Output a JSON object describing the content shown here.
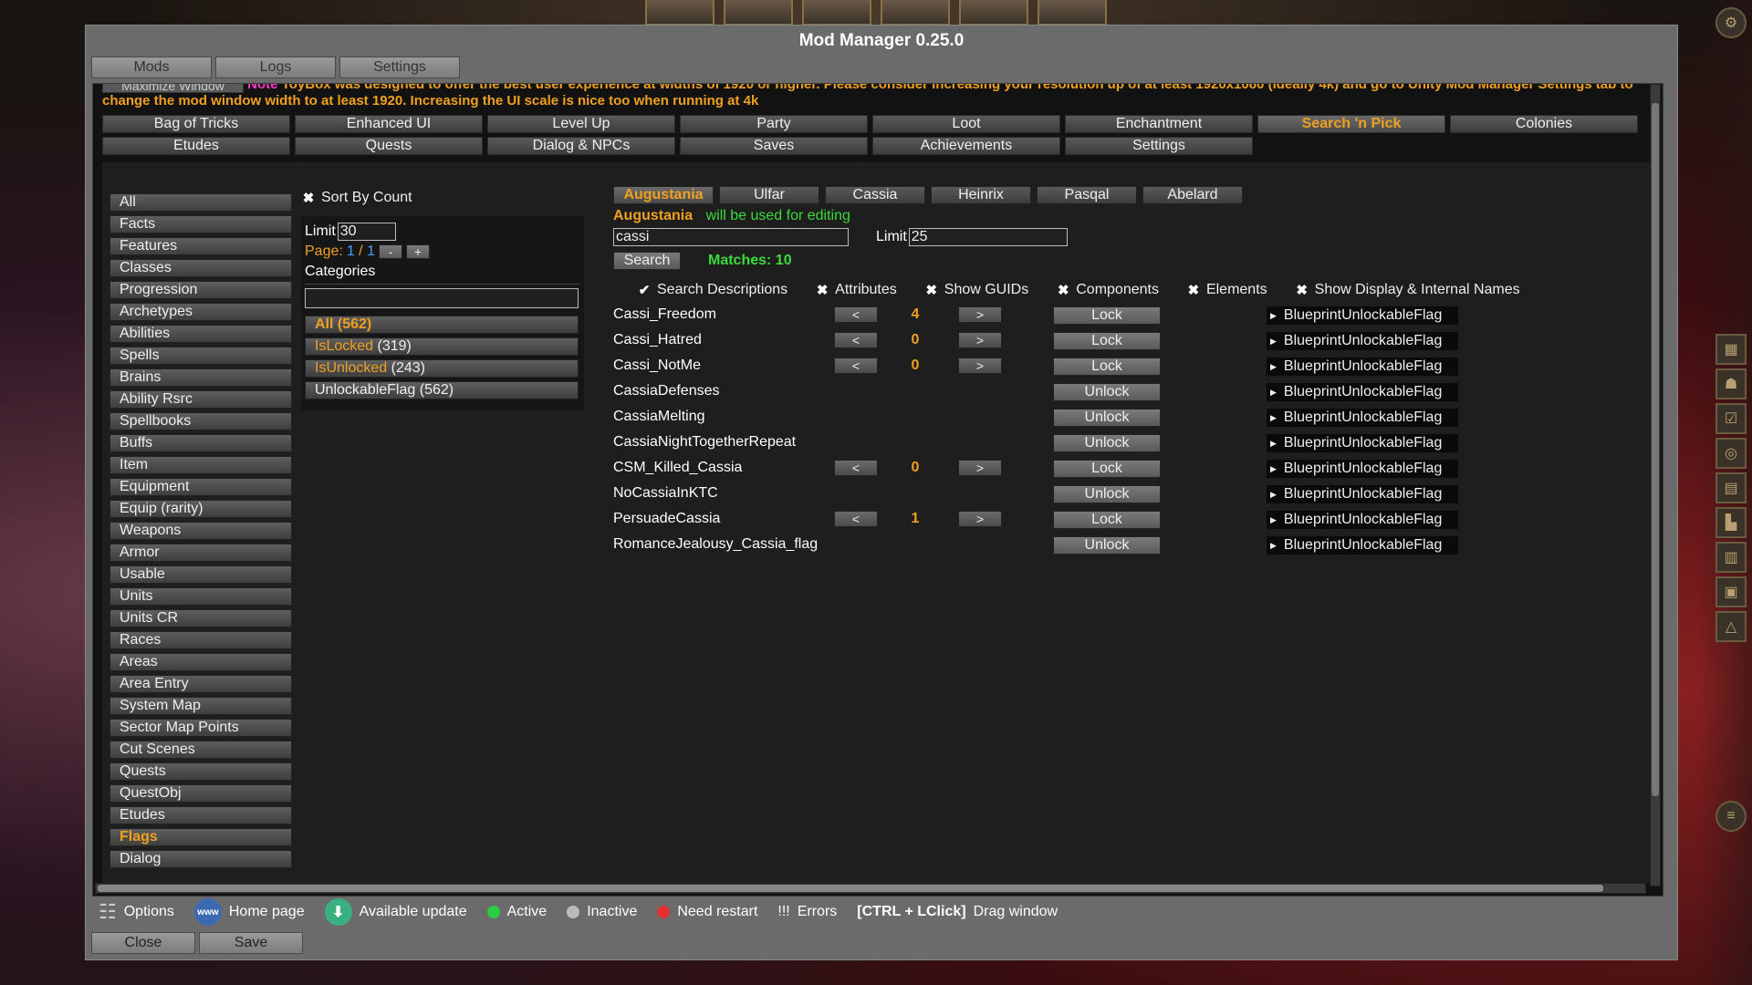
{
  "window_title": "Mod Manager 0.25.0",
  "tool_tabs": [
    "Mods",
    "Logs",
    "Settings"
  ],
  "note": {
    "maximize_label": "Maximize Window",
    "label": "Note",
    "text": "ToyBox was designed to offer the best user experience at widths of 1920 or higher. Please consider increasing your resolution up of at least 1920x1080 (ideally 4k) and go to Unity Mod Manager Settings tab to change the mod window width to at least 1920.  Increasing the UI scale is nice too when running at 4k"
  },
  "mod_tabs": [
    "Bag of Tricks",
    "Enhanced UI",
    "Level Up",
    "Party",
    "Loot",
    "Enchantment",
    "Search 'n Pick",
    "Colonies",
    "Etudes",
    "Quests",
    "Dialog & NPCs",
    "Saves",
    "Achievements",
    "Settings"
  ],
  "active_mod_tab": "Search 'n Pick",
  "categories": [
    "All",
    "Facts",
    "Features",
    "Classes",
    "Progression",
    "Archetypes",
    "Abilities",
    "Spells",
    "Brains",
    "Ability Rsrc",
    "Spellbooks",
    "Buffs",
    "Item",
    "Equipment",
    "Equip (rarity)",
    "Weapons",
    "Armor",
    "Usable",
    "Units",
    "Units CR",
    "Races",
    "Areas",
    "Area Entry",
    "System Map",
    "Sector Map Points",
    "Cut Scenes",
    "Quests",
    "QuestObj",
    "Etudes",
    "Flags",
    "Dialog"
  ],
  "active_category": "Flags",
  "filter": {
    "sort_by_count": "Sort By Count",
    "limit_label": "Limit",
    "limit_value": "30",
    "page_label": "Page:",
    "page_current": "1",
    "page_sep": " / ",
    "page_total": "1",
    "page_minus": "-",
    "page_plus": "+",
    "categories_label": "Categories",
    "categories_search": "",
    "category_filters": [
      {
        "name": "All",
        "count": "(562)",
        "style": "orange-bold"
      },
      {
        "name": "IsLocked",
        "count": "(319)",
        "style": "orange"
      },
      {
        "name": "IsUnlocked",
        "count": "(243)",
        "style": "orange"
      },
      {
        "name": "UnlockableFlag",
        "count": "(562)",
        "style": "normal"
      }
    ]
  },
  "characters": [
    "Augustania",
    "Ulfar",
    "Cassia",
    "Heinrix",
    "Pasqal",
    "Abelard"
  ],
  "active_character": "Augustania",
  "editing": {
    "name": "Augustania",
    "text": "will be used for editing"
  },
  "search": {
    "query": "cassi",
    "limit_label": "Limit",
    "limit_value": "25",
    "button": "Search",
    "matches": "Matches: 10"
  },
  "options": [
    {
      "label": "Search Descriptions",
      "mark": "✔"
    },
    {
      "label": "Attributes",
      "mark": "✖"
    },
    {
      "label": "Show GUIDs",
      "mark": "✖"
    },
    {
      "label": "Components",
      "mark": "✖"
    },
    {
      "label": "Elements",
      "mark": "✖"
    },
    {
      "label": "Show Display & Internal Names",
      "mark": "✖"
    }
  ],
  "results": [
    {
      "name": "Cassi_Freedom",
      "value": "4",
      "action": "Lock",
      "type": "BlueprintUnlockableFlag"
    },
    {
      "name": "Cassi_Hatred",
      "value": "0",
      "action": "Lock",
      "type": "BlueprintUnlockableFlag"
    },
    {
      "name": "Cassi_NotMe",
      "value": "0",
      "action": "Lock",
      "type": "BlueprintUnlockableFlag"
    },
    {
      "name": "CassiaDefenses",
      "value": "",
      "action": "Unlock",
      "type": "BlueprintUnlockableFlag"
    },
    {
      "name": "CassiaMelting",
      "value": "",
      "action": "Unlock",
      "type": "BlueprintUnlockableFlag"
    },
    {
      "name": "CassiaNightTogetherRepeat",
      "value": "",
      "action": "Unlock",
      "type": "BlueprintUnlockableFlag"
    },
    {
      "name": "CSM_Killed_Cassia",
      "value": "0",
      "action": "Lock",
      "type": "BlueprintUnlockableFlag"
    },
    {
      "name": "NoCassiaInKTC",
      "value": "",
      "action": "Unlock",
      "type": "BlueprintUnlockableFlag"
    },
    {
      "name": "PersuadeCassia",
      "value": "1",
      "action": "Lock",
      "type": "BlueprintUnlockableFlag"
    },
    {
      "name": "RomanceJealousy_Cassia_flag",
      "value": "",
      "action": "Unlock",
      "type": "BlueprintUnlockableFlag"
    }
  ],
  "arrows": {
    "left": "<",
    "right": ">"
  },
  "legend": {
    "options": "Options",
    "home": "Home page",
    "home_icon_text": "www",
    "update": "Available update",
    "active": "Active",
    "inactive": "Inactive",
    "restart": "Need restart",
    "errors_mark": "!!!",
    "errors": "Errors",
    "shortcut": "[CTRL + LClick]",
    "drag": "Drag window"
  },
  "colors": {
    "accent": "#f0a020",
    "active_dot": "#2ecc40",
    "inactive_dot": "#bbbbbb",
    "restart_dot": "#e03030"
  },
  "bottom_buttons": [
    "Close",
    "Save"
  ]
}
